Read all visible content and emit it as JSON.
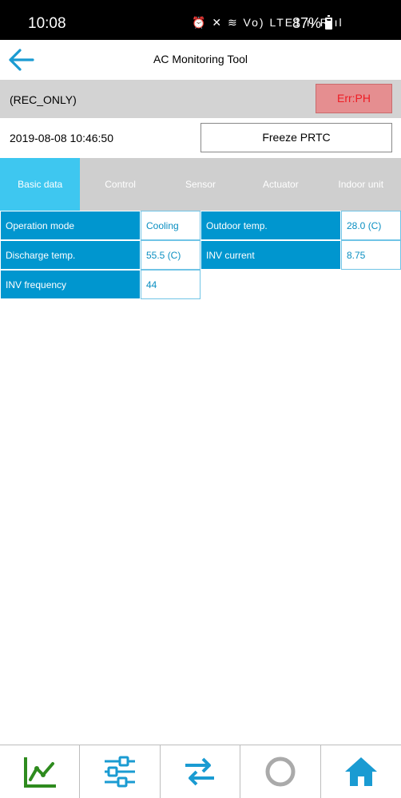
{
  "status_bar": {
    "time": "10:08",
    "icons_text": "⏰ ✕ ≋ Vo) LTE1 ıl R ıl",
    "battery": "87%"
  },
  "app_bar": {
    "back_icon": "arrow-left-icon",
    "title": "AC Monitoring Tool"
  },
  "status_row": {
    "mode": "(REC_ONLY)",
    "error": "Err:PH"
  },
  "time_row": {
    "timestamp": "2019-08-08 10:46:50",
    "freeze_label": "Freeze PRTC"
  },
  "tabs": [
    {
      "label": "Basic data",
      "active": true
    },
    {
      "label": "Control",
      "active": false
    },
    {
      "label": "Sensor",
      "active": false
    },
    {
      "label": "Actuator",
      "active": false
    },
    {
      "label": "Indoor unit",
      "active": false
    }
  ],
  "basic_data": [
    {
      "label": "Operation mode",
      "value": "Cooling"
    },
    {
      "label": "Outdoor temp.",
      "value": "28.0 (C)"
    },
    {
      "label": "Discharge temp.",
      "value": "55.5 (C)"
    },
    {
      "label": "INV current",
      "value": "8.75"
    },
    {
      "label": "INV frequency",
      "value": "44"
    }
  ],
  "bottom_nav": [
    {
      "icon": "line-chart-icon",
      "color": "#2e8b1e"
    },
    {
      "icon": "sliders-icon",
      "color": "#1a9bd2"
    },
    {
      "icon": "swap-arrows-icon",
      "color": "#1a9bd2"
    },
    {
      "icon": "circle-icon",
      "color": "#aaaaaa"
    },
    {
      "icon": "home-icon",
      "color": "#1a9bd2"
    }
  ],
  "colors": {
    "accent_blue": "#0096cf",
    "active_tab": "#3ec7f0",
    "error_bg": "#e58e90",
    "error_text": "#ee1c24"
  }
}
